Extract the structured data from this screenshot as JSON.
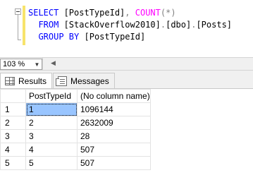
{
  "editor": {
    "line1": {
      "kw_select": "SELECT",
      "t_open": " [PostTypeId]",
      "comma": ",",
      "fn_count": " COUNT",
      "paren_open": "(",
      "star": "*",
      "paren_close": ")"
    },
    "line2": {
      "kw_from": "FROM",
      "t_table": " [StackOverflow2010]",
      "dot1": ".",
      "t_schema": "[dbo]",
      "dot2": ".",
      "t_posts": "[Posts]"
    },
    "line3": {
      "kw_group": "GROUP",
      "kw_by": " BY",
      "t_col": " [PostTypeId]"
    }
  },
  "zoom": {
    "value": "103 %"
  },
  "tabs": {
    "results": "Results",
    "messages": "Messages"
  },
  "grid": {
    "columns": [
      "",
      "PostTypeId",
      "(No column name)"
    ],
    "rows": [
      {
        "num": "1",
        "post_type_id": "1",
        "count": "1096144"
      },
      {
        "num": "2",
        "post_type_id": "2",
        "count": "2632009"
      },
      {
        "num": "3",
        "post_type_id": "3",
        "count": "28"
      },
      {
        "num": "4",
        "post_type_id": "4",
        "count": "507"
      },
      {
        "num": "5",
        "post_type_id": "5",
        "count": "507"
      }
    ]
  },
  "colors": {
    "keyword": "#0000ff",
    "function": "#ff00ff",
    "operator": "#808080",
    "selection": "#99c5ff"
  }
}
